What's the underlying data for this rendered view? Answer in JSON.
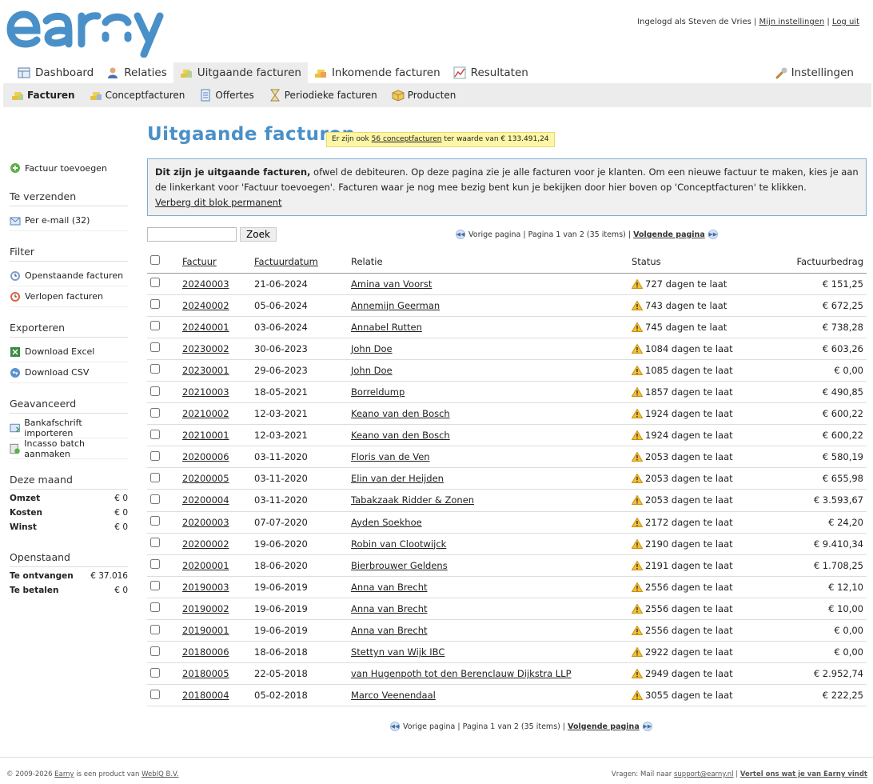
{
  "brand": {
    "logo_text": "earny",
    "accent": "#4a90c8"
  },
  "userbar": {
    "prefix": "Ingelogd als Steven de Vries |",
    "settings": "Mijn instellingen",
    "sep": "|",
    "logout": "Log uit"
  },
  "mainnav": [
    {
      "label": "Dashboard",
      "icon": "dashboard-icon"
    },
    {
      "label": "Relaties",
      "icon": "person-icon"
    },
    {
      "label": "Uitgaande facturen",
      "icon": "coins-icon",
      "active": true
    },
    {
      "label": "Inkomende facturen",
      "icon": "coins-icon"
    },
    {
      "label": "Resultaten",
      "icon": "chart-icon"
    }
  ],
  "settings_label": "Instellingen",
  "subnav": [
    {
      "label": "Facturen",
      "active": true
    },
    {
      "label": "Conceptfacturen"
    },
    {
      "label": "Offertes"
    },
    {
      "label": "Periodieke facturen"
    },
    {
      "label": "Producten"
    }
  ],
  "sidebar": {
    "add_invoice": "Factuur toevoegen",
    "to_send_heading": "Te verzenden",
    "per_email": "Per e-mail (32)",
    "filter_heading": "Filter",
    "filter_open": "Openstaande facturen",
    "filter_expired": "Verlopen facturen",
    "export_heading": "Exporteren",
    "export_excel": "Download Excel",
    "export_csv": "Download CSV",
    "advanced_heading": "Geavanceerd",
    "bank_import": "Bankafschrift importeren",
    "incasso": "Incasso batch aanmaken",
    "month_heading": "Deze maand",
    "month": [
      {
        "k": "Omzet",
        "v": "€ 0"
      },
      {
        "k": "Kosten",
        "v": "€ 0"
      },
      {
        "k": "Winst",
        "v": "€ 0"
      }
    ],
    "open_heading": "Openstaand",
    "open": [
      {
        "k": "Te ontvangen",
        "v": "€ 37.016"
      },
      {
        "k": "Te betalen",
        "v": "€ 0"
      }
    ]
  },
  "page_title": "Uitgaande facturen",
  "notice": {
    "pre": "Er zijn ook",
    "link": "56 conceptfacturen",
    "post": "ter waarde van € 133.491,24"
  },
  "infobox": {
    "bold": "Dit zijn je uitgaande facturen,",
    "text": " ofwel de debiteuren. Op deze pagina zie je alle facturen voor je klanten. Om een nieuwe factuur te maken, kies je aan de linkerkant voor 'Factuur toevoegen'. Facturen waar je nog mee bezig bent kun je bekijken door hier boven op 'Conceptfacturen' te klikken.",
    "hide_link": "Verberg dit blok permanent"
  },
  "search": {
    "button": "Zoek",
    "value": ""
  },
  "pager": {
    "prev": "Vorige pagina",
    "info": "| Pagina 1 van 2 (35 items) |",
    "next": "Volgende pagina"
  },
  "table": {
    "headers": {
      "invoice": "Factuur",
      "date": "Factuurdatum",
      "relation": "Relatie",
      "status": "Status",
      "amount": "Factuurbedrag"
    },
    "rows": [
      {
        "invoice": "20240003",
        "date": "21-06-2024",
        "relation": "Amina van Voorst",
        "status": "727 dagen te laat",
        "amount": "€ 151,25"
      },
      {
        "invoice": "20240002",
        "date": "05-06-2024",
        "relation": "Annemijn Geerman",
        "status": "743 dagen te laat",
        "amount": "€ 672,25"
      },
      {
        "invoice": "20240001",
        "date": "03-06-2024",
        "relation": "Annabel Rutten",
        "status": "745 dagen te laat",
        "amount": "€ 738,28"
      },
      {
        "invoice": "20230002",
        "date": "30-06-2023",
        "relation": "John Doe",
        "status": "1084 dagen te laat",
        "amount": "€ 603,26"
      },
      {
        "invoice": "20230001",
        "date": "29-06-2023",
        "relation": "John Doe",
        "status": "1085 dagen te laat",
        "amount": "€ 0,00"
      },
      {
        "invoice": "20210003",
        "date": "18-05-2021",
        "relation": "Borreldump",
        "status": "1857 dagen te laat",
        "amount": "€ 490,85"
      },
      {
        "invoice": "20210002",
        "date": "12-03-2021",
        "relation": "Keano van den Bosch",
        "status": "1924 dagen te laat",
        "amount": "€ 600,22"
      },
      {
        "invoice": "20210001",
        "date": "12-03-2021",
        "relation": "Keano van den Bosch",
        "status": "1924 dagen te laat",
        "amount": "€ 600,22"
      },
      {
        "invoice": "20200006",
        "date": "03-11-2020",
        "relation": "Floris van de Ven",
        "status": "2053 dagen te laat",
        "amount": "€ 580,19"
      },
      {
        "invoice": "20200005",
        "date": "03-11-2020",
        "relation": "Elin van der Heijden",
        "status": "2053 dagen te laat",
        "amount": "€ 655,98"
      },
      {
        "invoice": "20200004",
        "date": "03-11-2020",
        "relation": "Tabakzaak Ridder & Zonen",
        "status": "2053 dagen te laat",
        "amount": "€ 3.593,67"
      },
      {
        "invoice": "20200003",
        "date": "07-07-2020",
        "relation": "Ayden Soekhoe",
        "status": "2172 dagen te laat",
        "amount": "€ 24,20"
      },
      {
        "invoice": "20200002",
        "date": "19-06-2020",
        "relation": "Robin van Clootwijck",
        "status": "2190 dagen te laat",
        "amount": "€ 9.410,34"
      },
      {
        "invoice": "20200001",
        "date": "18-06-2020",
        "relation": "Bierbrouwer Geldens",
        "status": "2191 dagen te laat",
        "amount": "€ 1.708,25"
      },
      {
        "invoice": "20190003",
        "date": "19-06-2019",
        "relation": "Anna van Brecht",
        "status": "2556 dagen te laat",
        "amount": "€ 12,10"
      },
      {
        "invoice": "20190002",
        "date": "19-06-2019",
        "relation": "Anna van Brecht",
        "status": "2556 dagen te laat",
        "amount": "€ 10,00"
      },
      {
        "invoice": "20190001",
        "date": "19-06-2019",
        "relation": "Anna van Brecht",
        "status": "2556 dagen te laat",
        "amount": "€ 0,00"
      },
      {
        "invoice": "20180006",
        "date": "18-06-2018",
        "relation": "Stettyn van Wijk IBC",
        "status": "2922 dagen te laat",
        "amount": "€ 0,00"
      },
      {
        "invoice": "20180005",
        "date": "22-05-2018",
        "relation": "van Hugenpoth tot den Berenclauw Dijkstra LLP",
        "status": "2949 dagen te laat",
        "amount": "€ 2.952,74"
      },
      {
        "invoice": "20180004",
        "date": "05-02-2018",
        "relation": "Marco Veenendaal",
        "status": "3055 dagen te laat",
        "amount": "€ 222,25"
      }
    ]
  },
  "footer": {
    "left_pre": "© 2009-2026",
    "left_link": "Earny",
    "left_mid": "is een product van",
    "left_link2": "WebIQ B.V.",
    "right_pre": "Vragen: Mail naar",
    "right_mail": "support@earny.nl",
    "right_sep": "|",
    "right_link": "Vertel ons wat je van Earny vindt"
  }
}
